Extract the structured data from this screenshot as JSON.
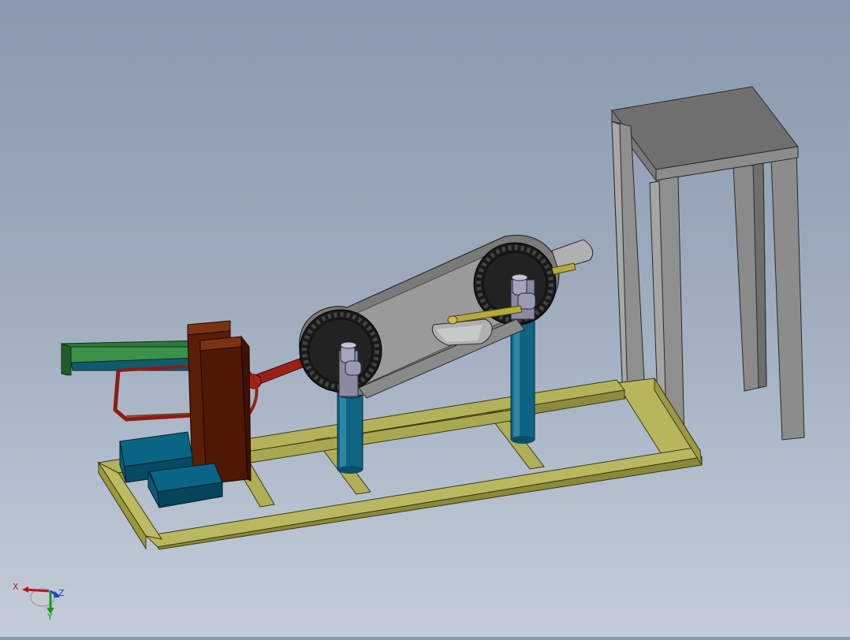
{
  "triad": {
    "x_label": "X",
    "y_label": "Y",
    "z_label": "Z",
    "colors": {
      "x": "#c0141a",
      "y": "#1a9a1a",
      "z": "#1f3fd0"
    }
  },
  "colors": {
    "frame": "#a7a64e",
    "frame_dark": "#6f6e2a",
    "column": "#0e5f80",
    "gear": "#1d1d1d",
    "belt": "#6d6d6d",
    "stand": "#8e8e8e",
    "brown_block": "#5a1d06",
    "green_arm": "#2e7a3b",
    "teal_base": "#05506c",
    "red_linkage": "#8e1b12",
    "yellow_rod": "#b0a63c"
  }
}
